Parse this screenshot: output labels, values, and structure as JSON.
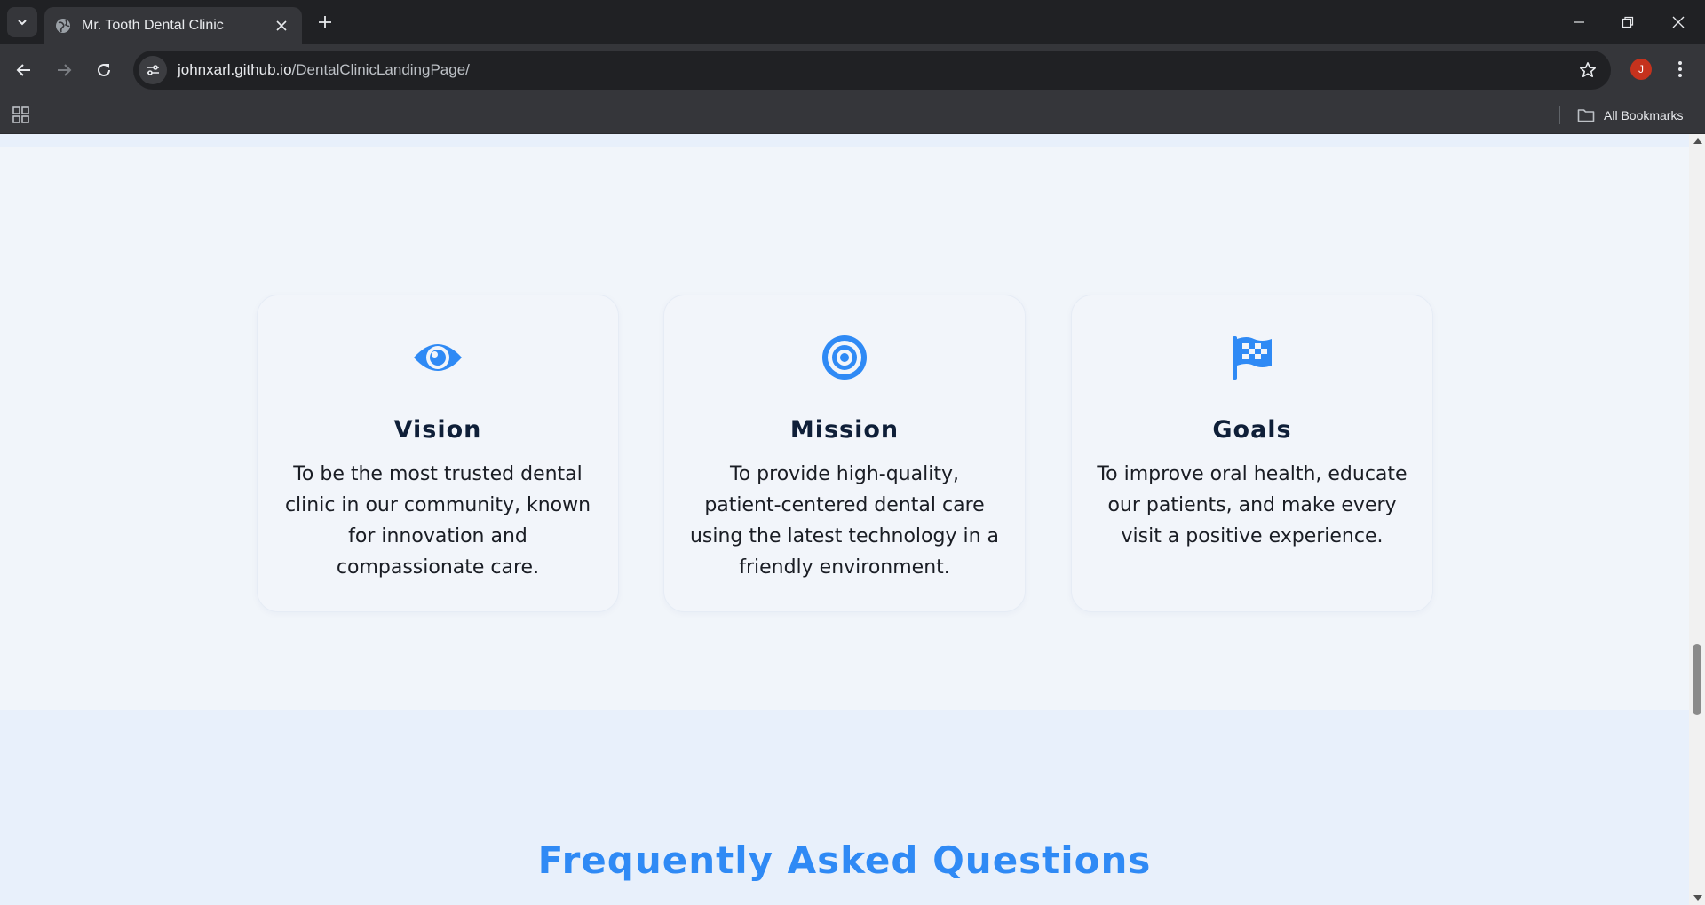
{
  "browser": {
    "tab_title": "Mr. Tooth Dental Clinic",
    "url_host": "johnxarl.github.io",
    "url_path": "/DentalClinicLandingPage/",
    "profile_initial": "J",
    "all_bookmarks_label": "All Bookmarks"
  },
  "cards": [
    {
      "icon": "eye-icon",
      "title": "Vision",
      "text": "To be the most trusted dental clinic in our community, known for innovation and compassionate care."
    },
    {
      "icon": "bullseye-icon",
      "title": "Mission",
      "text": "To provide high-quality, patient-centered dental care using the latest technology in a friendly environment."
    },
    {
      "icon": "checkered-flag-icon",
      "title": "Goals",
      "text": "To improve oral health, educate our patients, and make every visit a positive experience."
    }
  ],
  "faq": {
    "title": "Frequently Asked Questions"
  },
  "colors": {
    "accent": "#2f8af5",
    "heading": "#0f1f38",
    "section_bg": "#f1f5fa",
    "faq_bg": "#e8f0fb"
  }
}
